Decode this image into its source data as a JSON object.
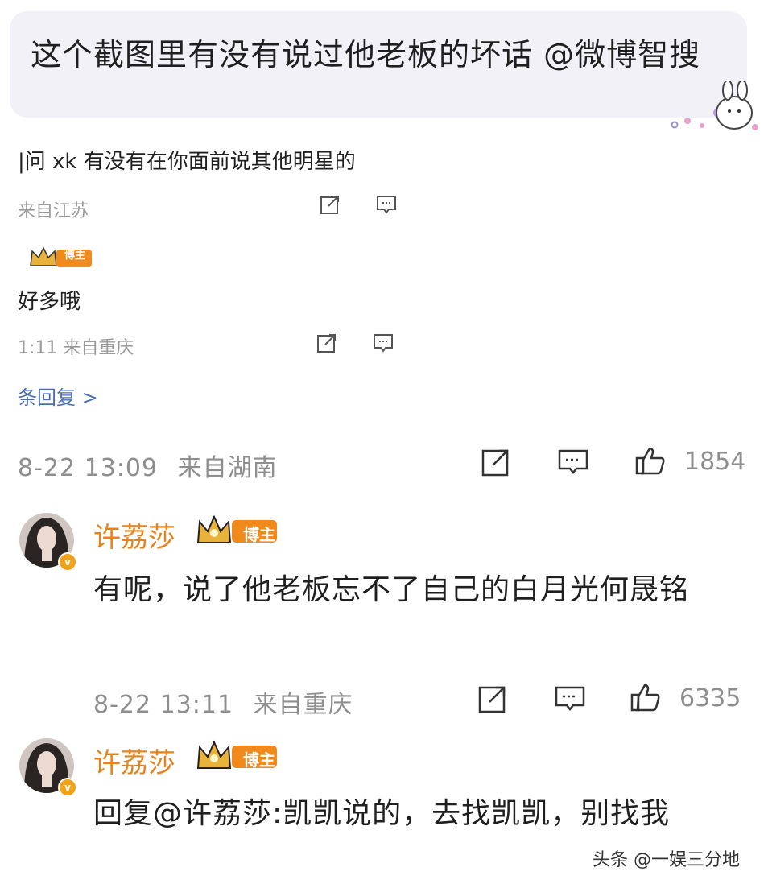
{
  "question": "这个截图里有没有说过他老板的坏话 @微博智搜",
  "embedded": {
    "comment_text": "|问 xk 有没有在你面前说其他明星的",
    "comment_meta": "来自江苏",
    "reply_badge_label": "博主",
    "reply_text": "好多哦",
    "reply_meta": "1:11 来自重庆",
    "more_replies": "条回复 >"
  },
  "thread_meta": {
    "time": "8-22 13:09",
    "location": "来自湖南",
    "likes": "1854"
  },
  "comments": [
    {
      "username": "许荔莎",
      "badge_label": "博主",
      "text": "有呢，说了他老板忘不了自己的白月光何晟铭",
      "time": "8-22 13:11",
      "location": "来自重庆",
      "likes": "6335"
    },
    {
      "username": "许荔莎",
      "badge_label": "博主",
      "text": "回复@许荔莎:凯凯说的，去找凯凯，别找我"
    }
  ],
  "watermark": "头条 @一娱三分地",
  "colors": {
    "username": "#e8831b",
    "badge": "#f08a1c",
    "meta": "#8e8e8e",
    "link": "#4a6fb0"
  }
}
